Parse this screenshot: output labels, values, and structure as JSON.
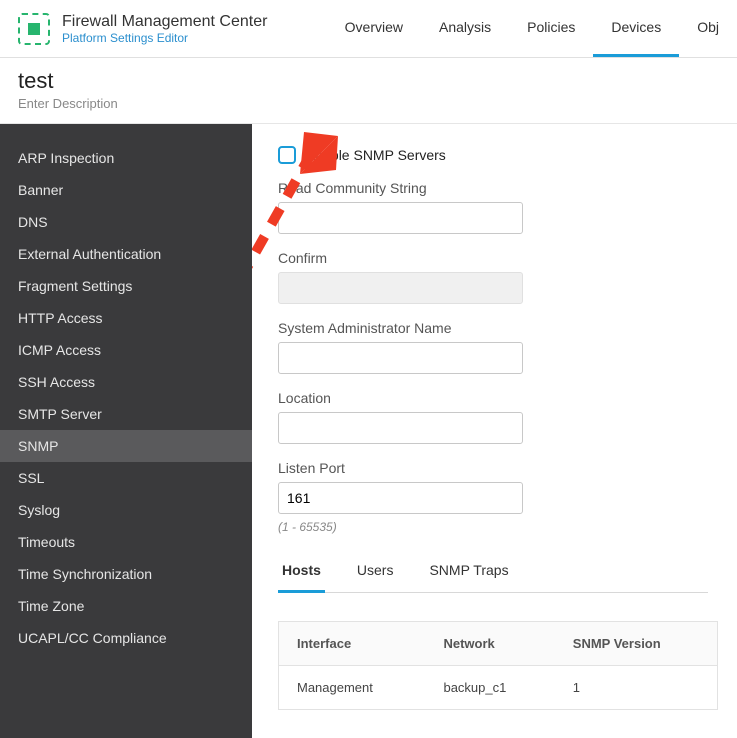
{
  "header": {
    "brand_title": "Firewall Management Center",
    "brand_sub": "Platform Settings Editor",
    "nav": [
      "Overview",
      "Analysis",
      "Policies",
      "Devices",
      "Obj"
    ],
    "nav_active": 3
  },
  "page": {
    "title": "test",
    "description": "Enter Description"
  },
  "sidebar": {
    "items": [
      "ARP Inspection",
      "Banner",
      "DNS",
      "External Authentication",
      "Fragment Settings",
      "HTTP Access",
      "ICMP Access",
      "SSH Access",
      "SMTP Server",
      "SNMP",
      "SSL",
      "Syslog",
      "Timeouts",
      "Time Synchronization",
      "Time Zone",
      "UCAPL/CC Compliance"
    ],
    "active": 9
  },
  "snmp": {
    "enable_label": "Enable SNMP Servers",
    "enable_checked": false,
    "read_community_label": "Read Community String",
    "read_community_value": "",
    "confirm_label": "Confirm",
    "confirm_value": "",
    "admin_label": "System Administrator Name",
    "admin_value": "",
    "location_label": "Location",
    "location_value": "",
    "port_label": "Listen Port",
    "port_value": "161",
    "port_hint": "(1 - 65535)",
    "tabs": [
      "Hosts",
      "Users",
      "SNMP Traps"
    ],
    "tab_active": 0,
    "table": {
      "headers": [
        "Interface",
        "Network",
        "SNMP Version"
      ],
      "rows": [
        {
          "interface": "Management",
          "network": "backup_c1",
          "version": "1"
        }
      ]
    }
  },
  "colors": {
    "accent": "#1a9cd8",
    "arrow": "#ef3b24"
  }
}
